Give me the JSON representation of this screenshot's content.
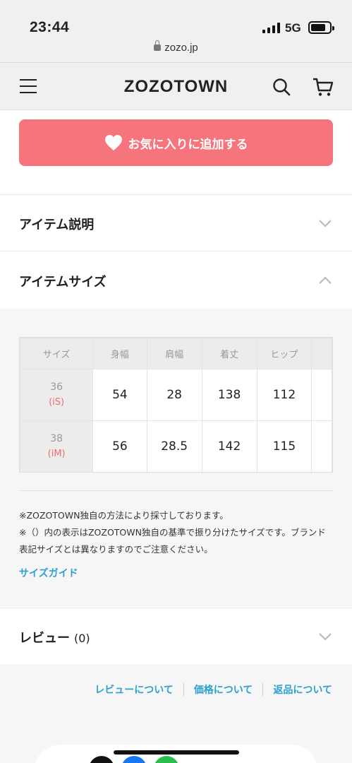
{
  "status_bar": {
    "time": "23:44",
    "network": "5G"
  },
  "browser": {
    "url": "zozo.jp"
  },
  "header": {
    "logo": "ZOZOTOWN"
  },
  "favorite_button": {
    "label": "お気に入りに追加する"
  },
  "sections": {
    "description": {
      "title": "アイテム説明"
    },
    "size": {
      "title": "アイテムサイズ"
    },
    "review": {
      "title": "レビュー",
      "count": "(0)"
    }
  },
  "size_table": {
    "headers": [
      "サイズ",
      "身幅",
      "肩幅",
      "着丈",
      "ヒップ"
    ],
    "rows": [
      {
        "size": "36",
        "mark": "S",
        "values": [
          "54",
          "28",
          "138",
          "112"
        ]
      },
      {
        "size": "38",
        "mark": "M",
        "values": [
          "56",
          "28.5",
          "142",
          "115"
        ]
      }
    ]
  },
  "notes": {
    "line1": "※ZOZOTOWN独自の方法により採寸しております。",
    "line2": "※（）内の表示はZOZOTOWN独自の基準で振り分けたサイズです。ブランド表記サイズとは異なりますのでご注意ください。"
  },
  "size_guide_link": "サイズガイド",
  "footer_links": [
    "レビューについて",
    "価格について",
    "返品について"
  ],
  "colors": {
    "favorite": "#f6747b",
    "link": "#2fa0d0"
  }
}
